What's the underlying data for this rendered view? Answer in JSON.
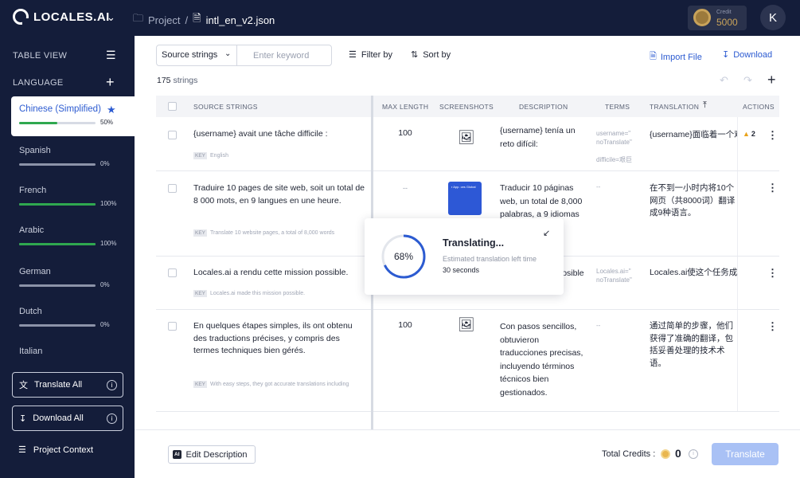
{
  "app": {
    "brand": "LOCALES.AI"
  },
  "breadcrumb": {
    "project": "Project",
    "separator": "/",
    "file": "intl_en_v2.json"
  },
  "credit": {
    "label": "Credit",
    "value": "5000"
  },
  "user": {
    "initial": "K"
  },
  "sidebar": {
    "table_view": "TABLE VIEW",
    "language_heading": "LANGUAGE",
    "languages": [
      {
        "name": "Chinese (Simplified)",
        "progress": 0.5,
        "percent": "50%",
        "active": true
      },
      {
        "name": "Spanish",
        "progress": 0,
        "percent": "0%"
      },
      {
        "name": "French",
        "progress": 1,
        "percent": "100%"
      },
      {
        "name": "Arabic",
        "progress": 1,
        "percent": "100%"
      },
      {
        "name": "German",
        "progress": 0,
        "percent": "0%"
      },
      {
        "name": "Dutch",
        "progress": 0,
        "percent": "0%"
      },
      {
        "name": "Italian"
      }
    ],
    "translate_all": "Translate All",
    "download_all": "Download All",
    "info_glyph": "i",
    "project_context": "Project Context"
  },
  "toolbar": {
    "source_select": "Source strings",
    "search_placeholder": "Enter keyword",
    "filter": "Filter by",
    "sort": "Sort by",
    "import": "Import File",
    "download": "Download",
    "count_value": "175",
    "count_suffix": " strings"
  },
  "table": {
    "headers": {
      "source": "SOURCE STRINGS",
      "max_length": "MAX LENGTH",
      "screenshots": "SCREENSHOTS",
      "description": "DESCRIPTION",
      "terms": "TERMS",
      "translation": "TRANSLATION",
      "actions": "ACTIONS"
    },
    "key_badge": "KEY",
    "rows": [
      {
        "source": "{username} avait une tâche difficile :",
        "key": "English",
        "max_length": "100",
        "description": "{username} tenía un reto difícil:",
        "terms": "username=\" noTranslate\"\n\ndifficile=艰巨",
        "translation": "{username}面临着一个艰巨",
        "warning_count": "2"
      },
      {
        "source": "Traduire 10 pages de site web, soit un total de 8 000 mots, en 9 langues en une heure.",
        "key": "Translate 10 website pages, a total of 8,000 words",
        "max_length": "--",
        "thumb_text": "r App. ces Global",
        "description": "Traducir 10 páginas web, un total de 8,000 palabras, a 9 idiomas en una hora de",
        "terms": "--",
        "translation": "在不到一小时内将10个网页（共8000词）翻译成9种语言。"
      },
      {
        "source": "Locales.ai a rendu cette mission possible.",
        "key": "Locales.ai made this mission possible.",
        "max_length": "",
        "description": "Locales.ai hizo posible esta misión.",
        "terms": "Locales.ai=\" noTranslate\"",
        "translation": "Locales.ai使这个任务成为可能。"
      },
      {
        "source": "En quelques étapes simples, ils ont obtenu des traductions précises, y compris des termes techniques bien gérés.",
        "key": "With easy steps, they got accurate translations including",
        "max_length": "100",
        "description": "Con pasos sencillos, obtuvieron traducciones precisas, incluyendo términos técnicos bien gestionados.",
        "terms": "--",
        "translation": "通过简单的步骤，他们获得了准确的翻译，包括妥善处理的技术术语。"
      }
    ]
  },
  "popup": {
    "title": "Translating...",
    "percent": "68%",
    "progress": 0.68,
    "subtitle": "Estimated translation left time",
    "time": "30 seconds"
  },
  "footer": {
    "edit_description": "Edit Description",
    "ai_badge": "AI",
    "total_credits_label": "Total Credits :",
    "total_credits_value": "0",
    "info_glyph": "i",
    "translate": "Translate"
  },
  "colors": {
    "nav": "#141d3a",
    "accent": "#2c5bd1",
    "progress": "#2fa84f",
    "warning": "#e8a21a"
  }
}
